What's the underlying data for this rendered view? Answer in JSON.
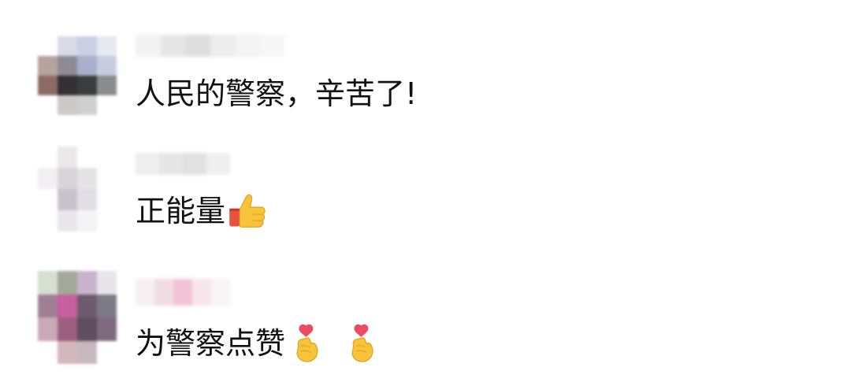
{
  "comments": [
    {
      "text": "人民的警察，辛苦了!",
      "emojis": [],
      "avatar_colors": [
        "#ffffff",
        "#d8dbe6",
        "#c9d0e4",
        "#e6e9f2",
        "#b4a39f",
        "#8e8b94",
        "#a8b0cc",
        "#c6cde0",
        "#8b6c63",
        "#343034",
        "#3a3d3e",
        "#8a8d8e",
        "#ffffff",
        "#cdc9c6",
        "#cfcfcf",
        "#ffffff"
      ],
      "username_colors": [
        "#f3f3f3",
        "#e6e6e6",
        "#dedede",
        "#ececec",
        "#f4f4f4",
        "#f7f7f7"
      ]
    },
    {
      "text": "正能量",
      "emojis": [
        "thumbs-up-icon"
      ],
      "avatar_colors": [
        "#ffffff",
        "#ebe8ea",
        "#ffffff",
        "#ffffff",
        "#f1eff1",
        "#d9d4d8",
        "#e6e3e6",
        "#ffffff",
        "#ffffff",
        "#c9c4cc",
        "#e2dee5",
        "#ffffff",
        "#ffffff",
        "#e9e7ec",
        "#f4f3f6",
        "#ffffff"
      ],
      "username_colors": [
        "#eeeeee",
        "#e6e6e6",
        "#e2e2e2",
        "#efefef"
      ]
    },
    {
      "text": "为警察点赞",
      "emojis": [
        "finger-heart-icon",
        "finger-heart-icon"
      ],
      "avatar_colors": [
        "#d7ded2",
        "#a3a99a",
        "#c8b3cc",
        "#e7e4ea",
        "#9f7f93",
        "#c85f9e",
        "#6d5a6f",
        "#7d7b86",
        "#c9a9b6",
        "#9c5f7f",
        "#5f4d60",
        "#7f6b7f",
        "#ffffff",
        "#d2b7bc",
        "#c7b8c0",
        "#ffffff"
      ],
      "username_colors": [
        "#f6f0f2",
        "#f0dde4",
        "#f2c3d4",
        "#f6e6ec",
        "#f9f4f6"
      ]
    }
  ]
}
